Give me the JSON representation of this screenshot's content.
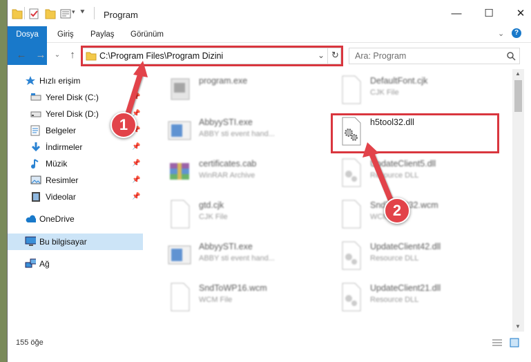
{
  "window": {
    "title": "Program",
    "minimize_glyph": "—",
    "maximize_glyph": "☐",
    "close_glyph": "✕"
  },
  "ribbon": {
    "tabs": [
      "Dosya",
      "Giriş",
      "Paylaş",
      "Görünüm"
    ]
  },
  "address": {
    "path": "C:\\Program Files\\Program Dizini"
  },
  "search": {
    "placeholder": "Ara: Program"
  },
  "sidebar": {
    "items": [
      {
        "label": "Hızlı erişim",
        "icon": "star-icon"
      },
      {
        "label": "Yerel Disk (C:)",
        "icon": "drive-icon"
      },
      {
        "label": "Yerel Disk (D:)",
        "icon": "drive-icon"
      },
      {
        "label": "Belgeler",
        "icon": "documents-icon"
      },
      {
        "label": "İndirmeler",
        "icon": "download-icon"
      },
      {
        "label": "Müzik",
        "icon": "music-icon"
      },
      {
        "label": "Resimler",
        "icon": "pictures-icon"
      },
      {
        "label": "Videolar",
        "icon": "videos-icon"
      },
      {
        "label": "OneDrive",
        "icon": "cloud-icon"
      },
      {
        "label": "Bu bilgisayar",
        "icon": "computer-icon"
      },
      {
        "label": "Ağ",
        "icon": "network-icon"
      }
    ]
  },
  "files": {
    "left": [
      {
        "name": "program.exe",
        "type": ""
      },
      {
        "name": "AbbyySTI.exe",
        "type": "ABBY sti event hand..."
      },
      {
        "name": "certificates.cab",
        "type": "WinRAR Archive"
      },
      {
        "name": "gtd.cjk",
        "type": "CJK File"
      },
      {
        "name": "AbbyySTI.exe",
        "type": "ABBY sti event hand..."
      },
      {
        "name": "SndToWP16.wcm",
        "type": "WCM File"
      }
    ],
    "right": [
      {
        "name": "DefaultFont.cjk",
        "type": "CJK File"
      },
      {
        "name": "h5tool32.dll",
        "type": ""
      },
      {
        "name": "UpdateClient5.dll",
        "type": "Resource DLL"
      },
      {
        "name": "SndToWP32.wcm",
        "type": "WCM File"
      },
      {
        "name": "UpdateClient42.dll",
        "type": "Resource DLL"
      },
      {
        "name": "UpdateClient21.dll",
        "type": "Resource DLL"
      }
    ]
  },
  "status": {
    "count": "155 öğe"
  },
  "markers": [
    "1",
    "2"
  ],
  "colors": {
    "accent": "#1979ca",
    "highlight": "#d9363e",
    "selection": "#cce4f7"
  }
}
